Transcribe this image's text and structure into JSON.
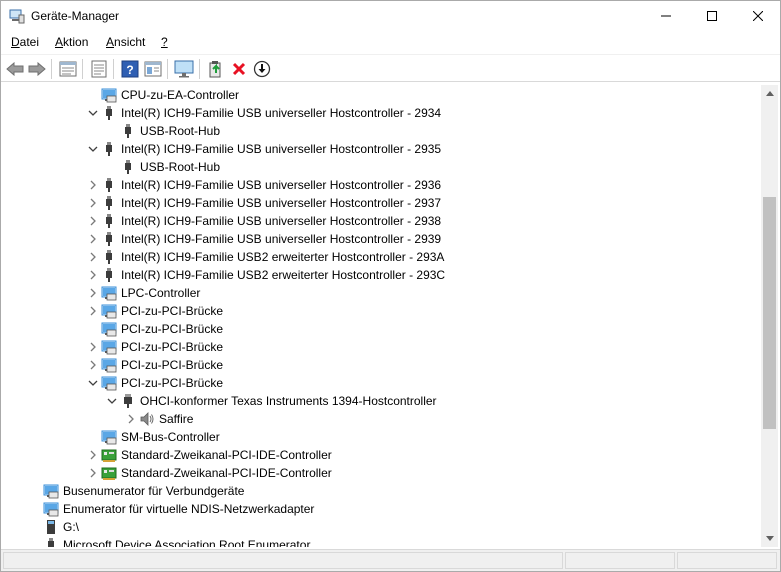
{
  "window": {
    "title": "Geräte-Manager"
  },
  "menu": [
    {
      "text": "Datei",
      "key": "D",
      "rest": "atei"
    },
    {
      "text": "Aktion",
      "key": "A",
      "rest": "ktion"
    },
    {
      "text": "Ansicht",
      "key": "A",
      "rest": "nsicht"
    },
    {
      "text": "?",
      "key": "?",
      "rest": ""
    }
  ],
  "toolbar": {
    "buttons": [
      "back-icon",
      "forward-icon",
      "properties-list-icon",
      "properties-icon",
      "help-icon",
      "view-icon",
      "monitor-icon",
      "update-driver-icon",
      "uninstall-icon",
      "download-icon"
    ]
  },
  "tree": [
    {
      "label": "CPU-zu-EA-Controller",
      "level": 2,
      "expander": "none",
      "icon": "pci"
    },
    {
      "label": "Intel(R) ICH9-Familie USB universeller Hostcontroller - 2934",
      "level": 2,
      "expander": "open",
      "icon": "usb"
    },
    {
      "label": "USB-Root-Hub",
      "level": 3,
      "expander": "none",
      "icon": "usb"
    },
    {
      "label": "Intel(R) ICH9-Familie USB universeller Hostcontroller - 2935",
      "level": 2,
      "expander": "open",
      "icon": "usb"
    },
    {
      "label": "USB-Root-Hub",
      "level": 3,
      "expander": "none",
      "icon": "usb"
    },
    {
      "label": "Intel(R) ICH9-Familie USB universeller Hostcontroller - 2936",
      "level": 2,
      "expander": "closed",
      "icon": "usb"
    },
    {
      "label": "Intel(R) ICH9-Familie USB universeller Hostcontroller - 2937",
      "level": 2,
      "expander": "closed",
      "icon": "usb"
    },
    {
      "label": "Intel(R) ICH9-Familie USB universeller Hostcontroller - 2938",
      "level": 2,
      "expander": "closed",
      "icon": "usb"
    },
    {
      "label": "Intel(R) ICH9-Familie USB universeller Hostcontroller - 2939",
      "level": 2,
      "expander": "closed",
      "icon": "usb"
    },
    {
      "label": "Intel(R) ICH9-Familie USB2 erweiterter Hostcontroller - 293A",
      "level": 2,
      "expander": "closed",
      "icon": "usb"
    },
    {
      "label": "Intel(R) ICH9-Familie USB2 erweiterter Hostcontroller - 293C",
      "level": 2,
      "expander": "closed",
      "icon": "usb"
    },
    {
      "label": "LPC-Controller",
      "level": 2,
      "expander": "closed",
      "icon": "pci"
    },
    {
      "label": "PCI-zu-PCI-Brücke",
      "level": 2,
      "expander": "closed",
      "icon": "pci"
    },
    {
      "label": "PCI-zu-PCI-Brücke",
      "level": 2,
      "expander": "none",
      "icon": "pci"
    },
    {
      "label": "PCI-zu-PCI-Brücke",
      "level": 2,
      "expander": "closed",
      "icon": "pci"
    },
    {
      "label": "PCI-zu-PCI-Brücke",
      "level": 2,
      "expander": "closed",
      "icon": "pci"
    },
    {
      "label": "PCI-zu-PCI-Brücke",
      "level": 2,
      "expander": "open",
      "icon": "pci"
    },
    {
      "label": "OHCI-konformer Texas Instruments 1394-Hostcontroller",
      "level": 3,
      "expander": "open",
      "icon": "firewire"
    },
    {
      "label": "Saffire",
      "level": 4,
      "expander": "closed",
      "icon": "speaker"
    },
    {
      "label": "SM-Bus-Controller",
      "level": 2,
      "expander": "none",
      "icon": "pci"
    },
    {
      "label": "Standard-Zweikanal-PCI-IDE-Controller",
      "level": 2,
      "expander": "closed",
      "icon": "ide"
    },
    {
      "label": "Standard-Zweikanal-PCI-IDE-Controller",
      "level": 2,
      "expander": "closed",
      "icon": "ide"
    },
    {
      "label": "Busenumerator für Verbundgeräte",
      "level": 0,
      "expander": "none",
      "icon": "pci"
    },
    {
      "label": "Enumerator für virtuelle NDIS-Netzwerkadapter",
      "level": 0,
      "expander": "none",
      "icon": "pci"
    },
    {
      "label": "G:\\",
      "level": 0,
      "expander": "none",
      "icon": "drive"
    },
    {
      "label": "Microsoft Device Association Root Enumerator",
      "level": 0,
      "expander": "none",
      "icon": "usb"
    }
  ],
  "colors": {
    "pci_blue": "#3a8fd8",
    "usb_gray": "#3c3c3c",
    "chevron": "#7a7a7a",
    "ide_green": "#2f8f2f",
    "uninstall_red": "#e81123"
  }
}
